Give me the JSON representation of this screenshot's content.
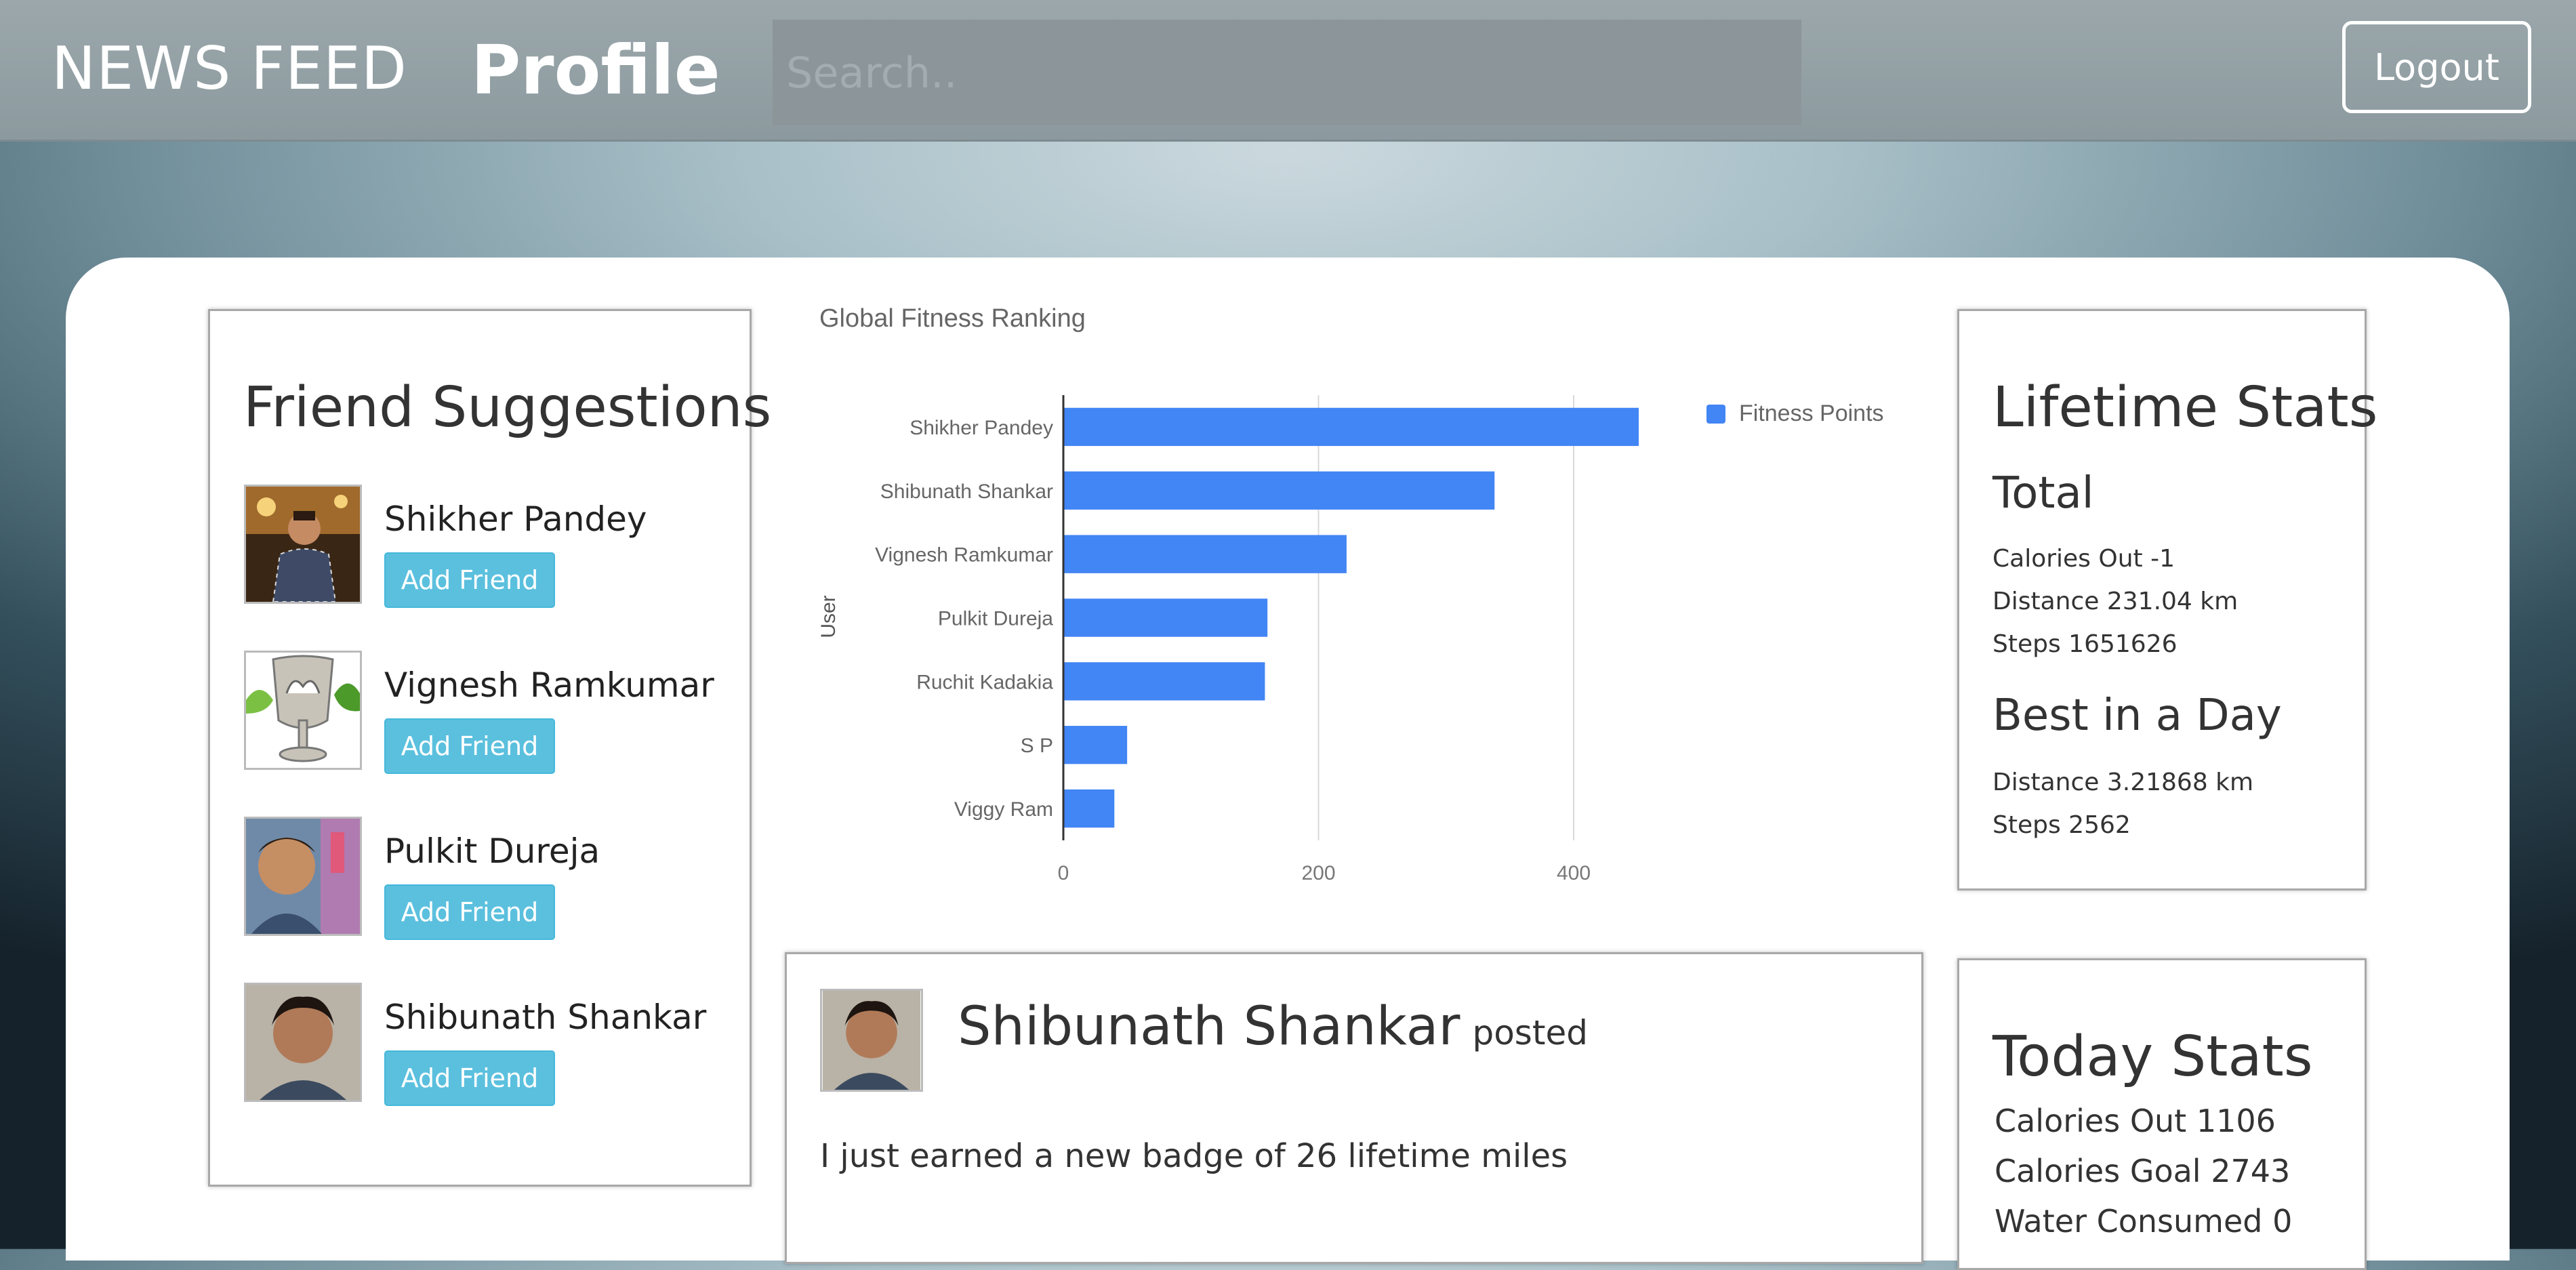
{
  "nav": {
    "news_feed": "NEWS FEED",
    "profile": "Profile",
    "search_placeholder": "Search..",
    "logout": "Logout"
  },
  "friend_suggestions": {
    "title": "Friend Suggestions",
    "button_label": "Add Friend",
    "friends": [
      {
        "name": "Shikher Pandey"
      },
      {
        "name": "Vignesh Ramkumar"
      },
      {
        "name": "Pulkit Dureja"
      },
      {
        "name": "Shibunath Shankar"
      }
    ]
  },
  "chart_data": {
    "type": "bar",
    "orientation": "horizontal",
    "title": "Global Fitness Ranking",
    "ylabel": "User",
    "xlabel": "",
    "categories": [
      "Shikher Pandey",
      "Shibunath Shankar",
      "Vignesh Ramkumar",
      "Pulkit Dureja",
      "Ruchit Kadakia",
      "S P",
      "Viggy Ram"
    ],
    "series": [
      {
        "name": "Fitness Points",
        "values": [
          451,
          338,
          222,
          160,
          158,
          50,
          40
        ],
        "color": "#4285f4"
      }
    ],
    "xlim": [
      0,
      451
    ],
    "xticks": [
      0,
      200,
      400
    ],
    "grid": true,
    "legend": "top-right"
  },
  "lifetime_stats": {
    "title": "Lifetime Stats",
    "total_heading": "Total",
    "total": [
      "Calories Out -1",
      "Distance 231.04 km",
      "Steps 1651626"
    ],
    "best_heading": "Best in a Day",
    "best": [
      "Distance 3.21868 km",
      "Steps 2562"
    ]
  },
  "today_stats": {
    "title": "Today Stats",
    "lines": [
      "Calories Out 1106",
      "Calories Goal 2743",
      "Water Consumed 0"
    ]
  },
  "post": {
    "author": "Shibunath Shankar",
    "verb": "posted",
    "text": "I just earned a new badge of 26 lifetime miles"
  }
}
